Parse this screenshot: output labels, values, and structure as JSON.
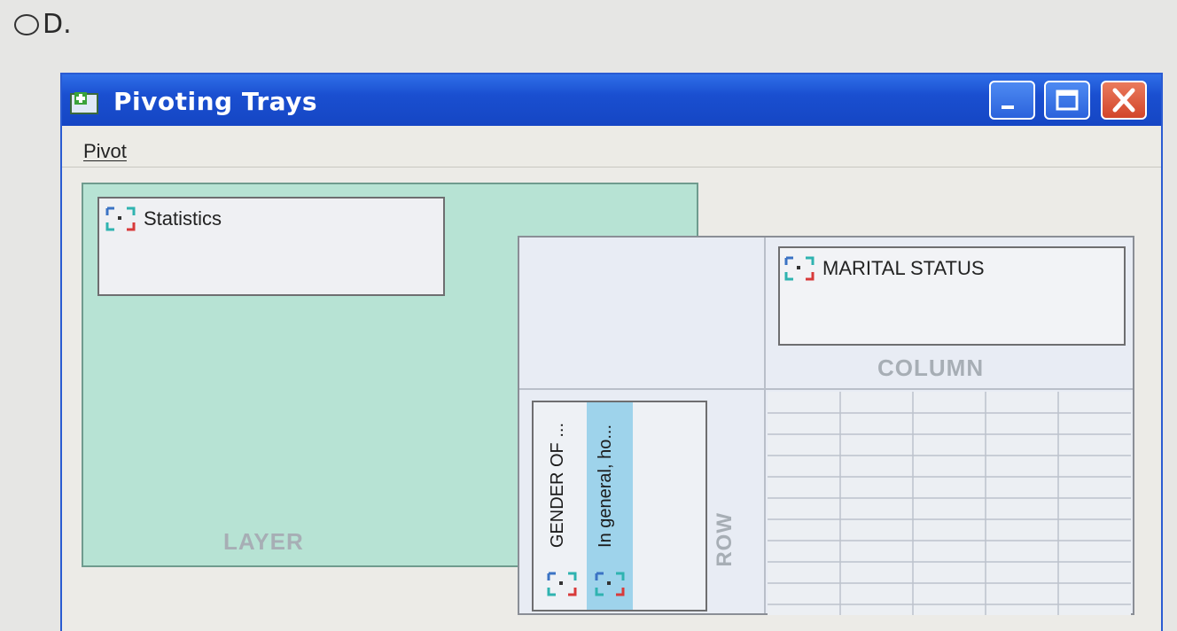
{
  "option": {
    "label": "D."
  },
  "window": {
    "title": "Pivoting Trays",
    "menu": {
      "pivot_label": "Pivot"
    }
  },
  "layer_tray": {
    "label": "LAYER",
    "items": [
      {
        "label": "Statistics",
        "icon": "pivot-dimension-icon"
      }
    ]
  },
  "column_tray": {
    "label": "COLUMN",
    "items": [
      {
        "label": "MARITAL STATUS",
        "icon": "pivot-dimension-icon"
      }
    ]
  },
  "row_tray": {
    "label": "ROW",
    "items": [
      {
        "label": "GENDER OF ...",
        "icon": "pivot-dimension-icon",
        "selected": false
      },
      {
        "label": "In general, ho...",
        "icon": "pivot-dimension-icon",
        "selected": true
      }
    ]
  },
  "colors": {
    "titlebar": "#1a4fd0",
    "layer_background": "#b7e3d4",
    "selected_strip": "#9ed3eb",
    "close_button": "#d2452a"
  }
}
